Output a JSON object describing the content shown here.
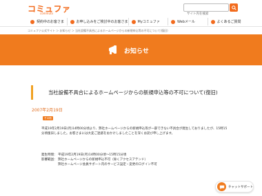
{
  "header": {
    "logo": "コミュファ",
    "logo_sub": "commufa",
    "search_placeholder": "サイト内を検索"
  },
  "nav": [
    {
      "label": "契約中のお客さま"
    },
    {
      "label": "お申し込みをご検討中のお客さま"
    },
    {
      "label": "Myコミュファ"
    },
    {
      "label": "Webメール"
    },
    {
      "label": "よくあるご質問"
    }
  ],
  "breadcrumb": "コミュファ公式サイト ＞ お知らせ ＞ 当社設備不具合によるホームページからの新規申込等の不可について(復旧)",
  "banner": {
    "title": "お知らせ"
  },
  "article": {
    "title": "当社設備不具合によるホームページからの新規申込等の不可について(復旧)",
    "date": "2007年2月19日",
    "tag": "その他",
    "body": "平成19年2月19日(月)14時00分頃より、弊社ホームページからの新規申込等が一部できない不具合が発生しておりましたが、15時15分頃復旧しました。お客さまには大変ご迷惑をおかけしましたことを深くお詫び申し上げます。",
    "details": [
      {
        "label": "発生時間：",
        "value": "平成19年2月19日(月)14時00分頃〜15時15分頃"
      },
      {
        "label": "影響範囲：",
        "value": "弊社ホームページからの新規申込不可（除くアクセスアテンド）"
      },
      {
        "label": "",
        "value": "弊社ホームページ会員サポート内のサービス設定・変更のログイン不可"
      }
    ]
  },
  "chat": {
    "label": "チャットサポート"
  },
  "colors": {
    "brand": "#f07b1e",
    "accent_bar": "#f0a020"
  }
}
